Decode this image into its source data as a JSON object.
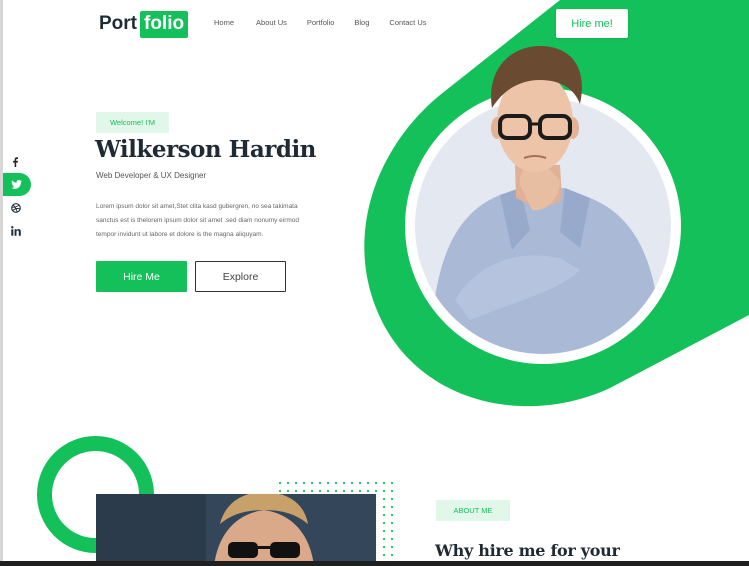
{
  "brand": {
    "logo_part1": "Port",
    "logo_part2": "folio"
  },
  "nav": {
    "items": [
      "Home",
      "About Us",
      "Portfolio",
      "Blog",
      "Contact Us"
    ]
  },
  "header": {
    "cta_label": "Hire me!"
  },
  "social": {
    "icons": [
      "facebook-icon",
      "twitter-icon",
      "dribbble-icon",
      "linkedin-icon"
    ],
    "active": "twitter-icon"
  },
  "hero": {
    "welcome": "Welcome! I'M",
    "name": "Wilkerson Hardin",
    "role": "Web Developer & UX Designer",
    "description_lines": [
      "Lorem ipsum dolor sit amet,Stet clita kasd gubergren, no sea takimata",
      "sanctus est is thelorem ipsum dolor sit amet .sed diam nonumy eirmod",
      "tempor invidunt ut labore et dolore is the magna aliquyam."
    ],
    "primary_button": "Hire Me",
    "secondary_button": "Explore"
  },
  "about": {
    "badge": "ABOUT ME",
    "heading": "Why hire me for your"
  },
  "colors": {
    "accent": "#14c05a",
    "accent_light": "#e1f7ea",
    "dark_text": "#1f2a35"
  }
}
